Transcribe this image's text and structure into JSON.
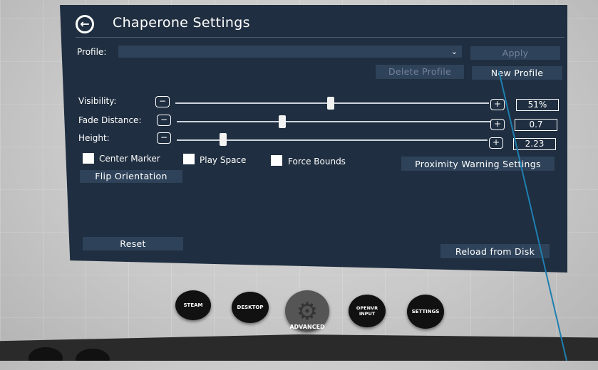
{
  "panel": {
    "title": "Chaperone Settings",
    "back_icon": "back-arrow-icon"
  },
  "profile": {
    "label": "Profile:",
    "selected": "",
    "apply_label": "Apply",
    "delete_label": "Delete Profile",
    "new_label": "New Profile"
  },
  "sliders": [
    {
      "label": "Visibility:",
      "value_text": "51%",
      "level": 0.51
    },
    {
      "label": "Fade Distance:",
      "value_text": "0.7",
      "level": 0.35
    },
    {
      "label": "Height:",
      "value_text": "2.23",
      "level": 0.15
    }
  ],
  "checkboxes": {
    "center_marker": "Center Marker",
    "play_space": "Play Space",
    "force_bounds": "Force Bounds"
  },
  "buttons": {
    "flip_orientation": "Flip Orientation",
    "proximity": "Proximity Warning Settings",
    "reset": "Reset",
    "reload": "Reload from Disk"
  },
  "dock": {
    "steam": "STEAM",
    "desktop": "DESKTOP",
    "advanced": "ADVANCED",
    "openvr_input": "OPENVR INPUT",
    "settings": "SETTINGS"
  },
  "colors": {
    "panel_bg": "#1f2e40",
    "button_bg": "#2e4259",
    "laser": "#1e7fb0"
  }
}
